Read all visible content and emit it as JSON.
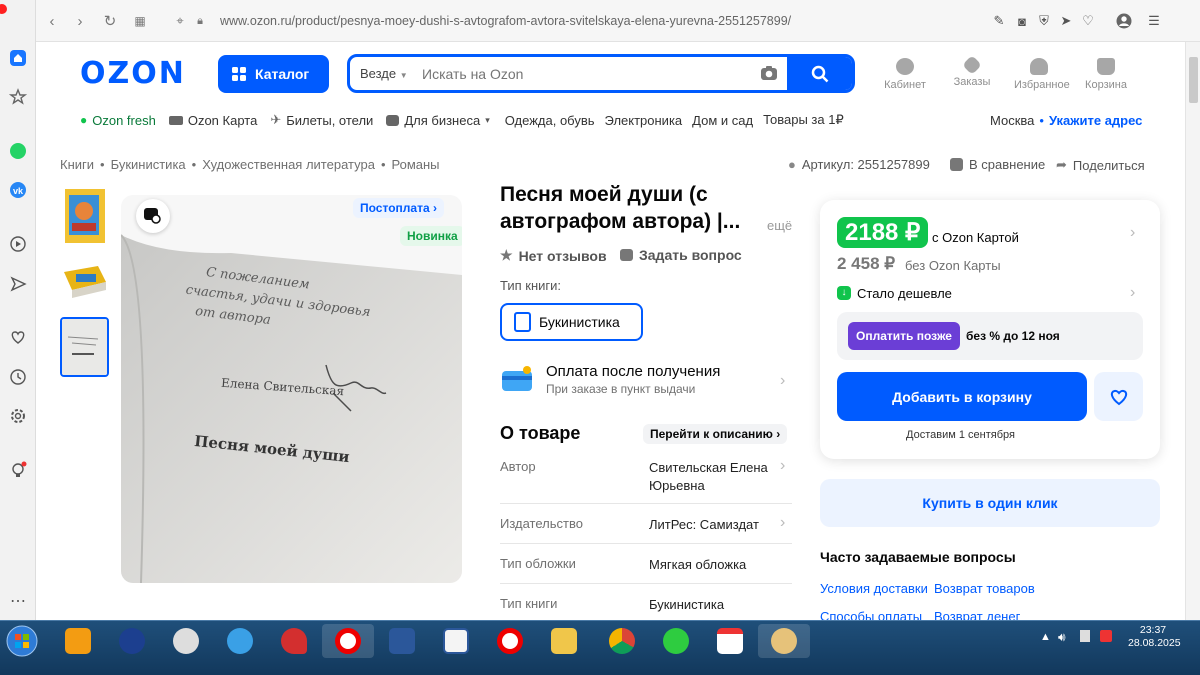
{
  "browser": {
    "url": "www.ozon.ru/product/pesnya-moey-dushi-s-avtografom-avtora-svitelskaya-elena-yurevna-2551257899/"
  },
  "header": {
    "logo": "OZON",
    "catalog_label": "Каталог",
    "search_scope": "Везде",
    "search_placeholder": "Искать на Ozon",
    "icons": [
      {
        "label": "Кабинет"
      },
      {
        "label": "Заказы"
      },
      {
        "label": "Избранное"
      },
      {
        "label": "Корзина"
      }
    ]
  },
  "subnav": {
    "items": [
      "Ozon fresh",
      "Ozon Карта",
      "Билеты, отели",
      "Для бизнеса",
      "Одежда, обувь",
      "Электроника",
      "Дом и сад",
      "Товары за 1₽"
    ],
    "city": "Москва",
    "address_link": "Укажите адрес"
  },
  "breadcrumbs": [
    "Книги",
    "Букинистика",
    "Художественная литература",
    "Романы"
  ],
  "meta": {
    "article": "Артикул: 2551257899",
    "compare": "В сравнение",
    "share": "Поделиться"
  },
  "gallery": {
    "postpay_badge": "Постоплата",
    "new_badge": "Новинка",
    "inscription_lines": [
      "С пожеланием",
      "счастья, удачи и здоровья",
      "от автора"
    ],
    "author_printed": "Елена Свительская",
    "book_title_printed": "Песня моей души"
  },
  "product": {
    "title": "Песня моей души (с автографом автора) |...",
    "more": "ещё",
    "reviews": "Нет отзывов",
    "ask": "Задать вопрос",
    "type_label": "Тип книги:",
    "type_chip": "Букинистика",
    "payment_title": "Оплата после получения",
    "payment_sub": "При заказе в пункт выдачи",
    "about_title": "О товаре",
    "about_link": "Перейти к описанию",
    "specs": [
      {
        "label": "Автор",
        "value": "Свительская Елена Юрьевна"
      },
      {
        "label": "Издательство",
        "value": "ЛитРес: Самиздат"
      },
      {
        "label": "Тип обложки",
        "value": "Мягкая обложка"
      },
      {
        "label": "Тип книги",
        "value": "Букинистика"
      }
    ]
  },
  "price_card": {
    "card_price": "2188 ₽",
    "card_price_label": "с Ozon Картой",
    "regular_price": "2 458 ₽",
    "regular_label": "без Ozon Карты",
    "cheaper_label": "Стало дешевле",
    "pay_later_label": "Оплатить позже",
    "pay_later_note": "без % до 12 ноя",
    "add_to_cart": "Добавить в корзину",
    "delivery": "Доставим 1 сентября",
    "buy_one_click": "Купить в один клик"
  },
  "faq": {
    "title": "Часто задаваемые вопросы",
    "links": [
      "Условия доставки",
      "Возврат товаров",
      "Способы оплаты",
      "Возврат денег"
    ]
  },
  "taskbar": {
    "time": "23:37",
    "date": "28.08.2025"
  },
  "colors": {
    "brand": "#005bff",
    "green": "#10c44c",
    "purple": "#6b3ed6"
  }
}
